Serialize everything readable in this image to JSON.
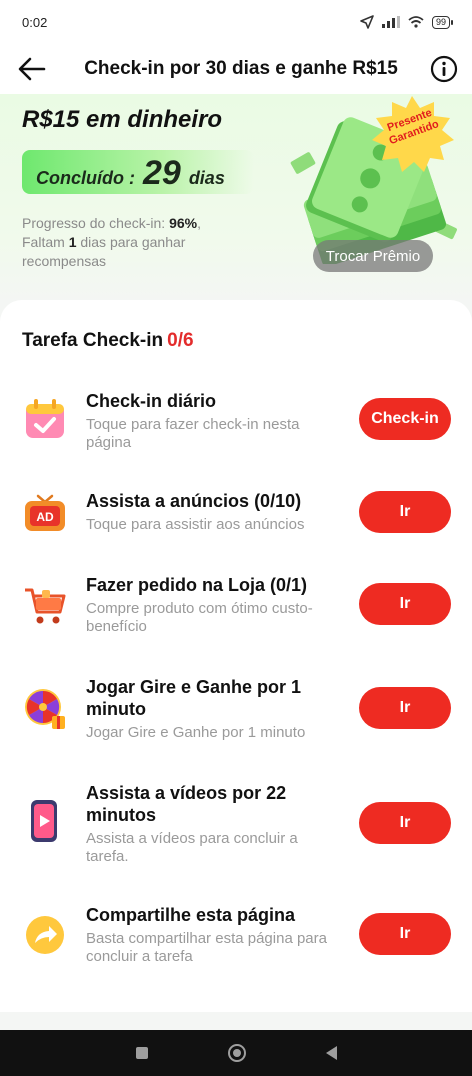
{
  "status_bar": {
    "time": "0:02",
    "battery": "99"
  },
  "header": {
    "title": "Check-in por 30 dias e ganhe R$15"
  },
  "hero": {
    "title": "R$15 em dinheiro",
    "completed_label": "Concluído :",
    "completed_days": "29",
    "completed_unit": "dias",
    "progress_prefix": "Progresso do check-in: ",
    "progress_value": "96%",
    "progress_sep": ",",
    "remaining_prefix": "Faltam ",
    "remaining_value": "1",
    "remaining_suffix": " dias para ganhar recompensas",
    "badge_line1": "Presente",
    "badge_line2": "Garantido",
    "swap_button": "Trocar Prêmio"
  },
  "tasks_section": {
    "title": "Tarefa Check-in",
    "count": "0/6",
    "items": [
      {
        "title": "Check-in diário",
        "desc": "Toque para fazer check-in nesta página",
        "button": "Check-in",
        "icon": "calendar-check-icon"
      },
      {
        "title": "Assista a anúncios  (0/10)",
        "desc": "Toque para assistir aos anúncios",
        "button": "Ir",
        "icon": "ad-tv-icon"
      },
      {
        "title": "Fazer pedido na Loja  (0/1)",
        "desc": "Compre produto com ótimo custo-benefício",
        "button": "Ir",
        "icon": "shopping-cart-icon"
      },
      {
        "title": "Jogar Gire e Ganhe por 1 minuto",
        "desc": "Jogar Gire e Ganhe por 1 minuto",
        "button": "Ir",
        "icon": "prize-wheel-icon"
      },
      {
        "title": "Assista a vídeos por 22 minutos",
        "desc": "Assista a vídeos para concluir a tarefa.",
        "button": "Ir",
        "icon": "video-phone-icon"
      },
      {
        "title": "Compartilhe esta página",
        "desc": "Basta compartilhar esta página para concluir a tarefa",
        "button": "Ir",
        "icon": "share-arrow-icon"
      }
    ]
  },
  "colors": {
    "accent_red": "#ee2b22",
    "count_red": "#e32c2c",
    "hero_green": "#6ee86e"
  }
}
